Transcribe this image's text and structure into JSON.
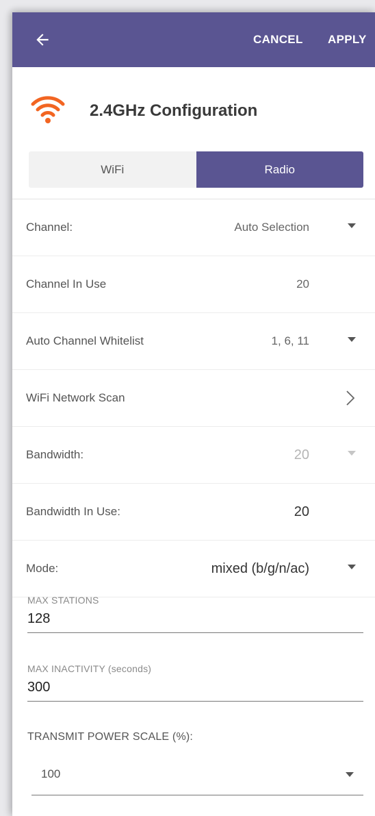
{
  "header": {
    "cancel_label": "CANCEL",
    "apply_label": "APPLY",
    "background": "#5a5592"
  },
  "page": {
    "title": "2.4GHz Configuration",
    "wifi_icon_color": "#f26522"
  },
  "tabs": [
    {
      "label": "WiFi",
      "active": false
    },
    {
      "label": "Radio",
      "active": true
    }
  ],
  "rows": {
    "channel": {
      "label": "Channel:",
      "value": "Auto Selection"
    },
    "channel_in_use": {
      "label": "Channel In Use",
      "value": "20"
    },
    "whitelist": {
      "label": "Auto Channel Whitelist",
      "value": "1, 6, 11"
    },
    "scan": {
      "label": "WiFi Network Scan"
    },
    "bandwidth": {
      "label": "Bandwidth:",
      "value": "20"
    },
    "bandwidth_in_use": {
      "label": "Bandwidth In Use:",
      "value": "20"
    },
    "mode": {
      "label": "Mode:",
      "value": "mixed (b/g/n/ac)"
    }
  },
  "fields": {
    "max_stations": {
      "label": "MAX STATIONS",
      "value": "128"
    },
    "max_inactivity": {
      "label": "MAX INACTIVITY (seconds)",
      "value": "300"
    }
  },
  "transmit_power": {
    "label": "TRANSMIT POWER SCALE (%):",
    "value": "100"
  }
}
